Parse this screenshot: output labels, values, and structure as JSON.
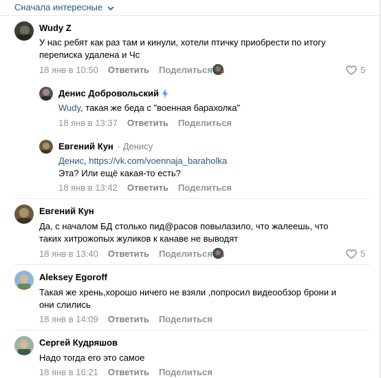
{
  "sort": {
    "label": "Сначала интересные"
  },
  "actions": {
    "reply": "Ответить",
    "share": "Поделиться"
  },
  "comments": [
    {
      "author": "Wudy Z",
      "lines": [
        "У нас ребят как раз там и кинули, хотели птичку приобрести по итогу",
        "переписка удалена и Чс"
      ],
      "date": "18 янв в 10:50",
      "likes": "5"
    },
    {
      "author": "Денис Добровольский",
      "mention": "Wudy",
      "text_rest": ", такая же беда с \"военная барахолка\"",
      "date": "18 янв в 13:37"
    },
    {
      "author": "Евгений Кун",
      "to": "· Денису",
      "mention": "Денис",
      "link": "https://vk.com/voennaja_baraholka",
      "line2": "Эта? Или ещё какая-то есть?",
      "date": "18 янв в 13:42"
    },
    {
      "author": "Евгений Кун",
      "lines": [
        "Да, с началом БД столько пид@расов повылазило, что жалеешь, что",
        "таких хитрожопых жуликов к канаве не выводят"
      ],
      "date": "18 янв в 13:40",
      "likes": "5"
    },
    {
      "author": "Aleksey Egoroff",
      "lines": [
        "Такая же хрень,хорошо ничего не взяли ,попросил видеообзор брони и",
        "они слились"
      ],
      "date": "18 янв в 14:09"
    },
    {
      "author": "Сергей Кудряшов",
      "lines": [
        "Надо тогда его это самое"
      ],
      "date": "18 янв в 16:21"
    }
  ],
  "colors": {
    "link": "#2a5885",
    "muted": "#939393",
    "separator": "#e7e8ec",
    "bolt": "#4a9cf0",
    "heart": "#ff3347"
  }
}
